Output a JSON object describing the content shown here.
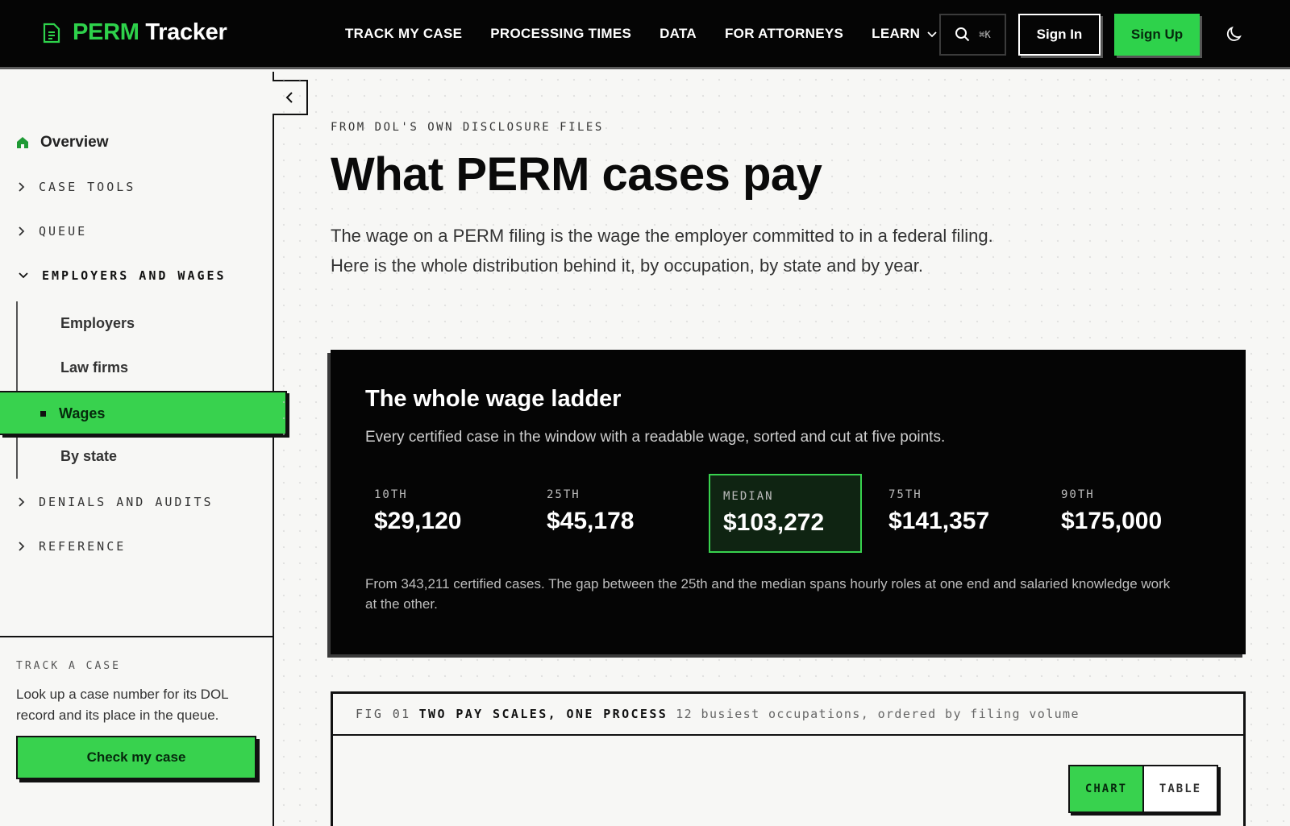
{
  "brand": {
    "name_a": "PERM",
    "name_b": "Tracker",
    "accent": "#2ed24b"
  },
  "nav": {
    "items": [
      "TRACK MY CASE",
      "PROCESSING TIMES",
      "DATA",
      "FOR ATTORNEYS",
      "LEARN"
    ],
    "search_shortcut": "⌘K",
    "signin": "Sign In",
    "signup": "Sign Up"
  },
  "sidebar": {
    "overview": "Overview",
    "groups": {
      "case_tools": "CASE TOOLS",
      "queue": "QUEUE",
      "employers_and_wages": "EMPLOYERS AND WAGES",
      "denials_and_audits": "DENIALS AND AUDITS",
      "reference": "REFERENCE"
    },
    "sub_items": [
      "Employers",
      "Law firms",
      "Wages",
      "By state"
    ],
    "active": "Wages",
    "track": {
      "kicker": "TRACK A CASE",
      "text": "Look up a case number for its DOL record and its place in the queue.",
      "button": "Check my case"
    }
  },
  "main": {
    "kicker": "FROM DOL'S OWN DISCLOSURE FILES",
    "title": "What PERM cases pay",
    "lead": "The wage on a PERM filing is the wage the employer committed to in a federal filing. Here is the whole distribution behind it, by occupation, by state and by year.",
    "ladder": {
      "title": "The whole wage ladder",
      "subtitle": "Every certified case in the window with a readable wage, sorted and cut at five points.",
      "percentiles": [
        {
          "label": "10TH",
          "value": "$29,120"
        },
        {
          "label": "25TH",
          "value": "$45,178"
        },
        {
          "label": "MEDIAN",
          "value": "$103,272"
        },
        {
          "label": "75TH",
          "value": "$141,357"
        },
        {
          "label": "90TH",
          "value": "$175,000"
        }
      ],
      "note": "From 343,211 certified cases. The gap between the 25th and the median spans hourly roles at one end and salaried knowledge work at the other."
    },
    "figure": {
      "number": "FIG 01",
      "title": "TWO PAY SCALES, ONE PROCESS",
      "description": "12 busiest occupations, ordered by filing volume",
      "toggle_chart": "CHART",
      "toggle_table": "TABLE"
    }
  }
}
